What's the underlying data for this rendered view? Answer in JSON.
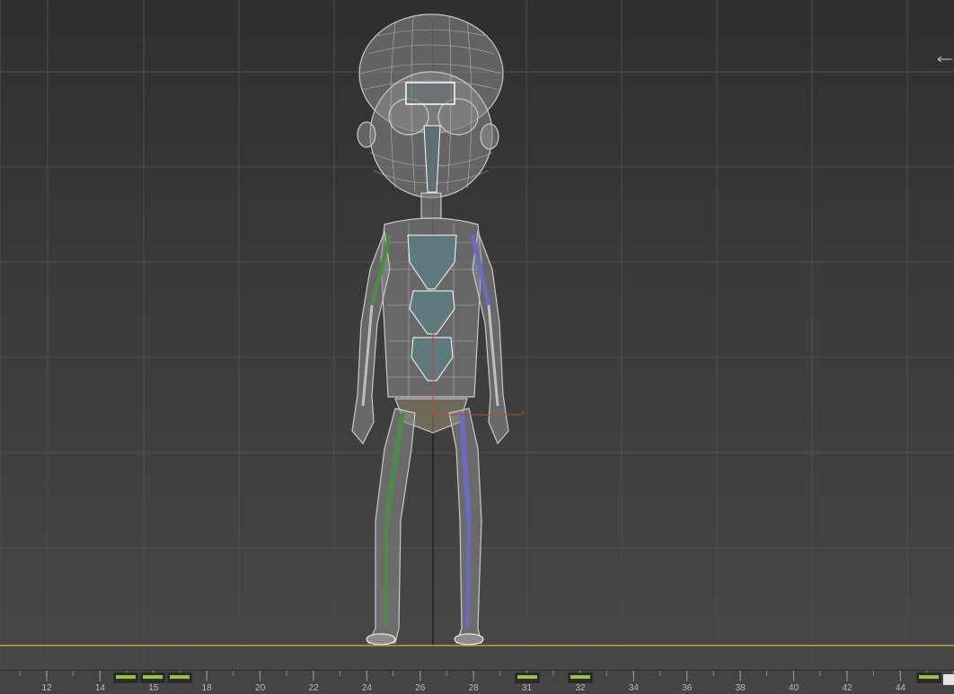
{
  "viewport": {
    "background_top": "#2f2f2f",
    "background_bottom": "#474747",
    "grid_color": "#4e4e4e",
    "ground_line_color": "#b8a24a",
    "axis_line_color": "#111111",
    "gizmo_color": "#d33a3a"
  },
  "character": {
    "mesh_color": "#9a9a9a",
    "wire_color": "#c8c8c8",
    "spine_box_color": "#5f7a7c",
    "left_limb_bone_color": "#4e8a4a",
    "right_limb_bone_color": "#6a6ac0",
    "pelvis_color": "#c9b98a"
  },
  "timeline": {
    "tick_labels": [
      "12",
      "14",
      "15",
      "18",
      "20",
      "22",
      "24",
      "26",
      "28",
      "31",
      "32",
      "34",
      "36",
      "38",
      "40",
      "42",
      "44"
    ],
    "key_color": "#8fc63a",
    "keyframes": [
      "15",
      "15",
      "18",
      "31",
      "32",
      "44"
    ]
  }
}
